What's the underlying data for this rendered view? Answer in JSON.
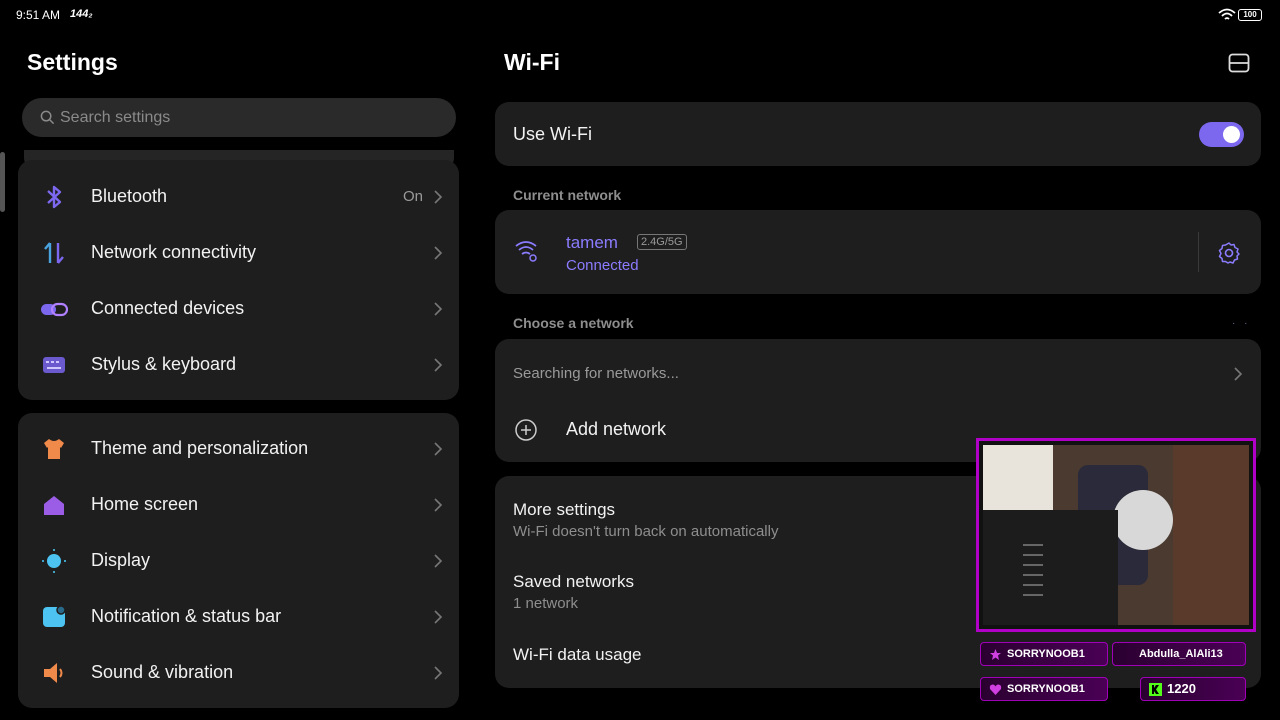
{
  "status_bar": {
    "time": "9:51 AM",
    "refresh_rate": "144₂",
    "battery": "100"
  },
  "left": {
    "title": "Settings",
    "search_placeholder": "Search settings",
    "group1": [
      {
        "label": "Bluetooth",
        "value": "On",
        "icon": "bluetooth-icon"
      },
      {
        "label": "Network connectivity",
        "value": "",
        "icon": "network-icon"
      },
      {
        "label": "Connected devices",
        "value": "",
        "icon": "connected-devices-icon"
      },
      {
        "label": "Stylus & keyboard",
        "value": "",
        "icon": "keyboard-icon"
      }
    ],
    "group2": [
      {
        "label": "Theme and personalization",
        "icon": "theme-icon"
      },
      {
        "label": "Home screen",
        "icon": "home-icon"
      },
      {
        "label": "Display",
        "icon": "display-icon"
      },
      {
        "label": "Notification & status bar",
        "icon": "notification-icon"
      },
      {
        "label": "Sound & vibration",
        "icon": "sound-icon"
      }
    ]
  },
  "right": {
    "title": "Wi-Fi",
    "use_wifi_label": "Use Wi-Fi",
    "use_wifi_on": true,
    "current_network_header": "Current network",
    "current_network": {
      "name": "tamem",
      "band": "2.4G/5G",
      "status": "Connected"
    },
    "choose_header": "Choose a network",
    "searching_text": "Searching for networks...",
    "add_network_label": "Add network",
    "more_settings_title": "More settings",
    "more_settings_sub": "Wi-Fi doesn't turn back on automatically",
    "saved_networks_title": "Saved networks",
    "saved_networks_sub": "1 network",
    "data_usage_label": "Wi-Fi data usage"
  },
  "stream_overlay": {
    "row1_left": "SORRYNOOB1",
    "row1_right": "Abdulla_AlAli13",
    "row2_left": "SORRYNOOB1",
    "row2_right": "1220"
  },
  "colors": {
    "accent": "#7b68ee",
    "overlay": "#b000c8"
  }
}
